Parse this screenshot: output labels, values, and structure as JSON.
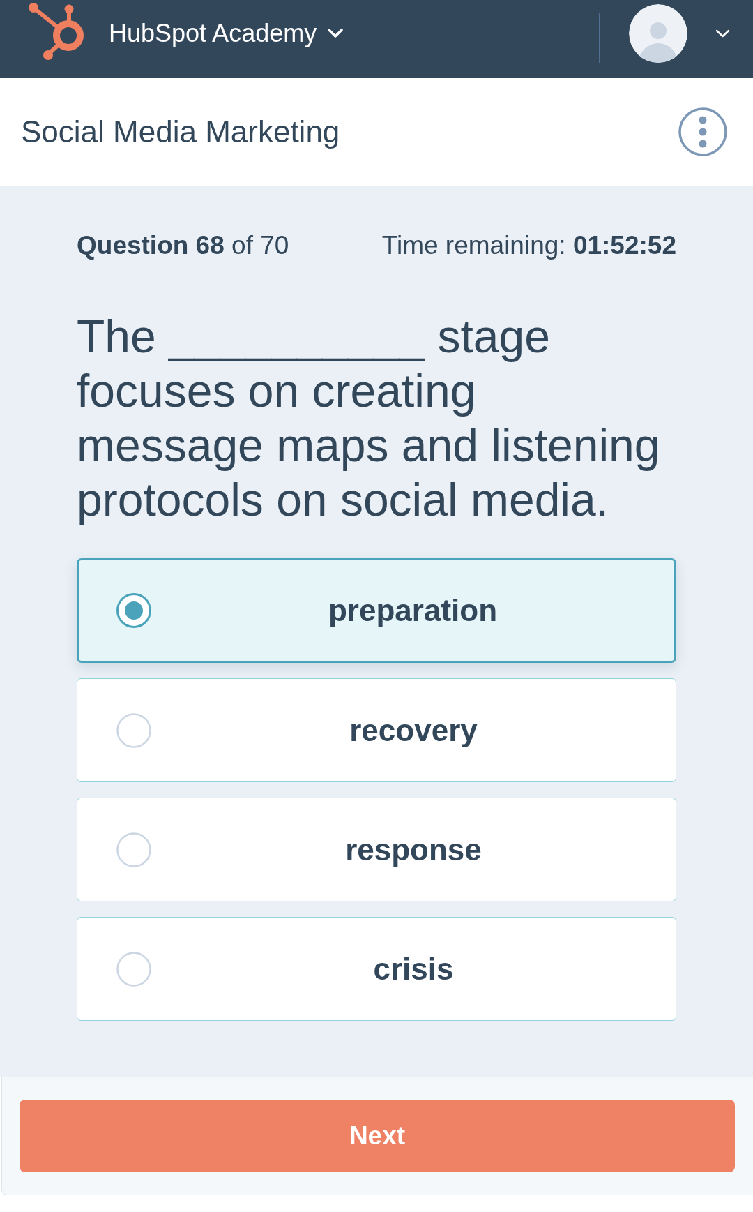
{
  "top_bar": {
    "app_menu": "HubSpot Academy"
  },
  "course_header": {
    "title": "Social Media Marketing"
  },
  "quiz": {
    "progress": "**Question 68** of 70",
    "time_remaining": "Time remaining: **01:52:52**",
    "question": "The __________ stage focuses on creating message maps and listening protocols on social media.",
    "options": [
      {
        "label": "preparation",
        "selected": true
      },
      {
        "label": "recovery",
        "selected": false
      },
      {
        "label": "response",
        "selected": false
      },
      {
        "label": "crisis",
        "selected": false
      }
    ]
  },
  "footer": {
    "next_button": "Next"
  }
}
